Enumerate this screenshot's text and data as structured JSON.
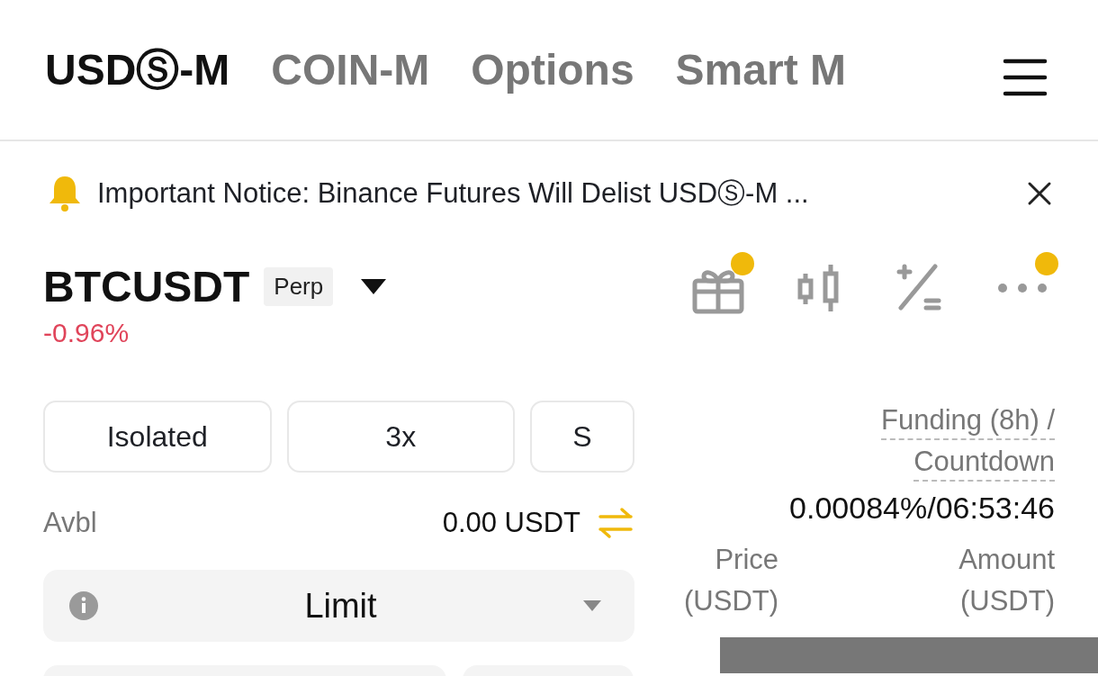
{
  "tabs": [
    {
      "label": "USDⓈ-M",
      "selected": true
    },
    {
      "label": "COIN-M",
      "selected": false
    },
    {
      "label": "Options",
      "selected": false
    },
    {
      "label": "Smart M",
      "selected": false
    }
  ],
  "notice": {
    "text": "Important Notice: Binance Futures Will Delist USDⓈ-M ..."
  },
  "symbol": {
    "name": "BTCUSDT",
    "badge": "Perp",
    "change": "-0.96%"
  },
  "toolbar": [
    {
      "kind": "gift",
      "dot": true
    },
    {
      "kind": "candles",
      "dot": false
    },
    {
      "kind": "calculator",
      "dot": false
    },
    {
      "kind": "more",
      "dot": true
    }
  ],
  "order_settings": [
    "Isolated",
    "3x",
    "S"
  ],
  "available": {
    "label": "Avbl",
    "value": "0.00 USDT"
  },
  "order_type": {
    "value": "Limit"
  },
  "funding": {
    "label_1": "Funding (8h) /",
    "label_2": "Countdown",
    "value": "0.00084%/06:53:46"
  },
  "order_book": {
    "columns": [
      {
        "title": "Price",
        "unit": "(USDT)"
      },
      {
        "title": "Amount",
        "unit": "(USDT)"
      }
    ]
  }
}
